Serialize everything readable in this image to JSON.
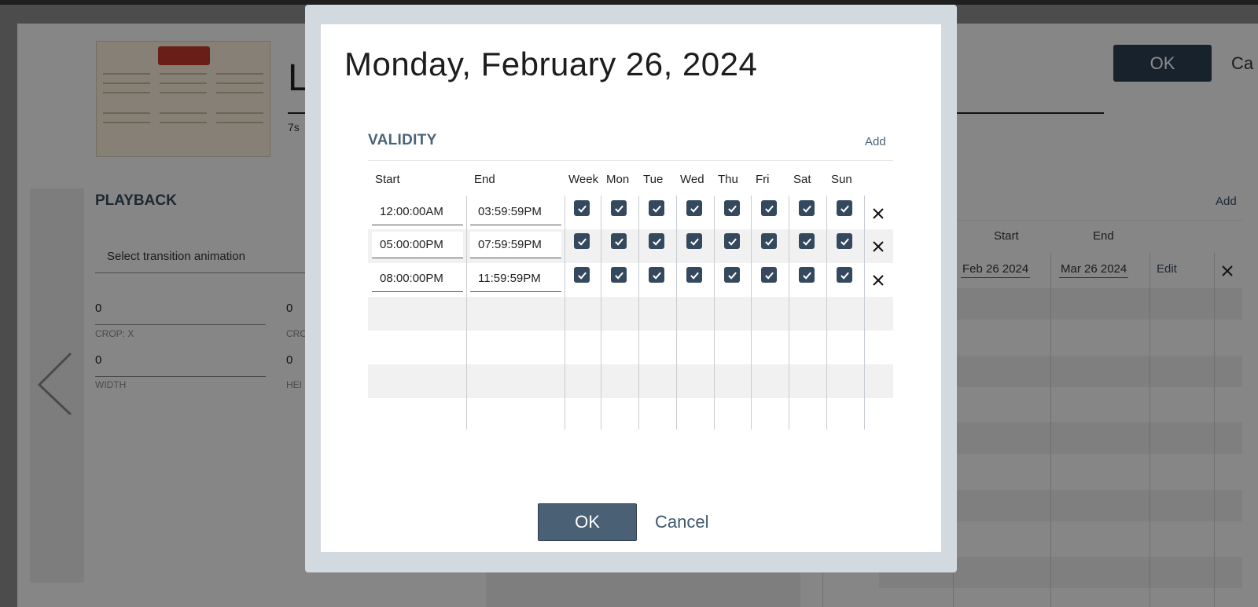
{
  "background": {
    "title_partial": "L",
    "duration_partial": "7s",
    "ok_label": "OK",
    "cancel_partial": "Ca",
    "playback_title": "PLAYBACK",
    "transition_placeholder": "Select transition animation",
    "fields": [
      {
        "value": "0",
        "label": "CROP: X"
      },
      {
        "value": "0",
        "label": "CRO"
      },
      {
        "value": "0",
        "label": "WIDTH"
      },
      {
        "value": "0",
        "label": "HEI"
      }
    ],
    "schedule": {
      "add_label": "Add",
      "col_start": "Start",
      "col_end": "End",
      "row": {
        "start": "Feb 26 2024",
        "end": "Mar 26 2024",
        "edit": "Edit"
      }
    }
  },
  "modal": {
    "title": "Monday, February 26, 2024",
    "section_title": "VALIDITY",
    "add_label": "Add",
    "headers": {
      "start": "Start",
      "end": "End",
      "days": [
        "Week",
        "Mon",
        "Tue",
        "Wed",
        "Thu",
        "Fri",
        "Sat",
        "Sun"
      ]
    },
    "rows": [
      {
        "start": "12:00:00AM",
        "end": "03:59:59PM",
        "checked": [
          true,
          true,
          true,
          true,
          true,
          true,
          true,
          true
        ]
      },
      {
        "start": "05:00:00PM",
        "end": "07:59:59PM",
        "checked": [
          true,
          true,
          true,
          true,
          true,
          true,
          true,
          true
        ]
      },
      {
        "start": "08:00:00PM",
        "end": "11:59:59PM",
        "checked": [
          true,
          true,
          true,
          true,
          true,
          true,
          true,
          true
        ]
      }
    ],
    "ok_label": "OK",
    "cancel_label": "Cancel"
  },
  "colors": {
    "accent": "#34495e",
    "ok_button": "#4a6074",
    "overlay": "rgba(0,0,0,0.45)",
    "modal_frame": "#d2d9df"
  }
}
